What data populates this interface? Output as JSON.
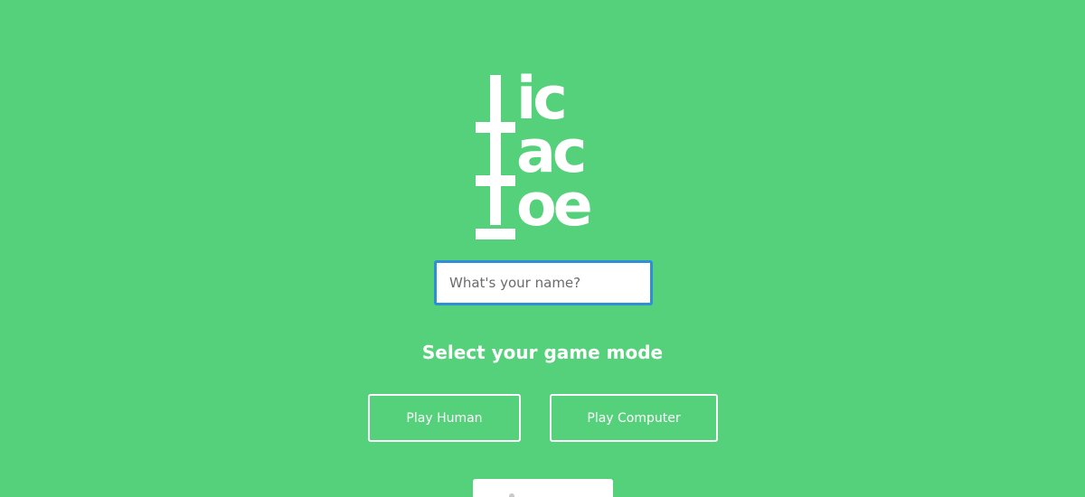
{
  "logo": {
    "line1": "ic",
    "line2": "ac",
    "line3": "oe",
    "text": "Tic Tac Toe"
  },
  "name_input": {
    "value": "",
    "placeholder": "What's your name?"
  },
  "mode_heading": "Select your game mode",
  "buttons": {
    "play_human": "Play Human",
    "play_computer": "Play Computer"
  },
  "colors": {
    "background": "#55d17b",
    "text": "#ffffff",
    "input_focus_border": "#2e8fd6"
  }
}
